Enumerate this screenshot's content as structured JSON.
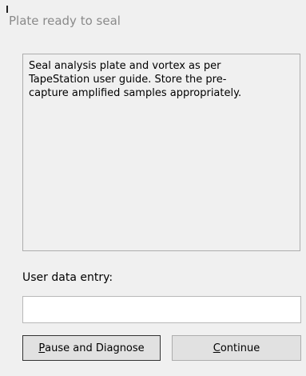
{
  "dialog": {
    "title": "Plate ready to seal",
    "message": "Seal analysis plate and vortex as per\nTapeStation user guide. Store the pre-\ncapture amplified samples appropriately.",
    "user_entry_label": "User data entry:",
    "user_entry_value": "",
    "buttons": {
      "pause": {
        "mnemonic": "P",
        "rest": "ause and Diagnose"
      },
      "continue": {
        "mnemonic": "C",
        "rest": "ontinue"
      }
    }
  }
}
